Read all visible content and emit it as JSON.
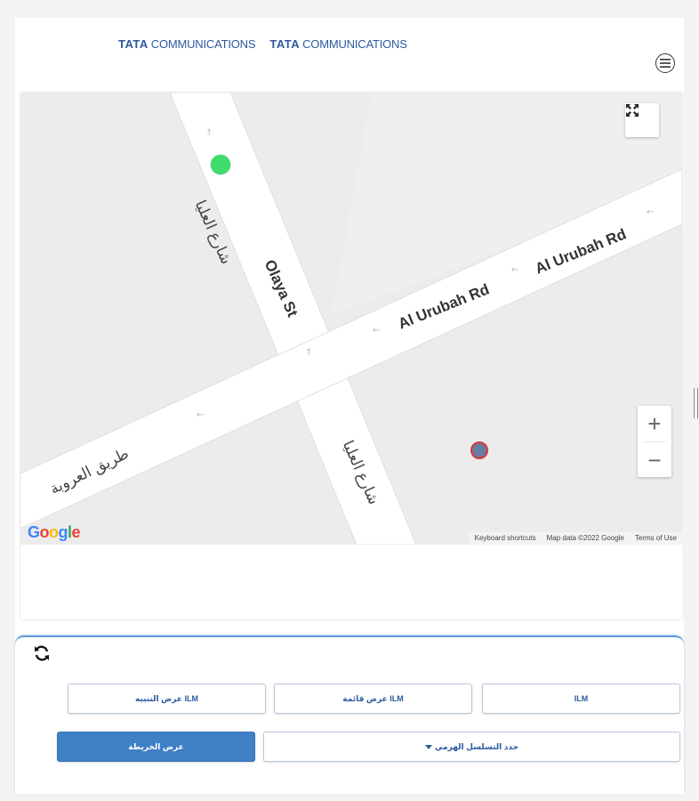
{
  "header": {
    "logos": [
      {
        "brand": "TATA",
        "name": "COMMUNICATIONS"
      },
      {
        "brand": "TATA",
        "name": "COMMUNICATIONS"
      }
    ]
  },
  "map": {
    "labels": {
      "olaya_en": "Olaya St",
      "olaya_ar_top": "شارع العليا",
      "olaya_ar_bottom": "شارع العليا",
      "urubah_1": "Al Urubah Rd",
      "urubah_2": "Al Urubah Rd",
      "urubah_ar": "طريق العروبة"
    },
    "google_logo": "Google",
    "footer": {
      "shortcuts": "Keyboard shortcuts",
      "map_data": "Map Data",
      "copyright": "Map data ©2022 Google",
      "terms": "Terms of Use"
    },
    "zoom_in": "+",
    "zoom_out": "−",
    "colors": {
      "marker_green": "#3ddc6b",
      "marker_red": "#d9383a"
    }
  },
  "controls": {
    "row1": {
      "ilm": "ILM",
      "ilm_list": "عرض قائمة ILM",
      "ilm_alarm": "عرض التنبيه ILM"
    },
    "row2": {
      "hierarchy": "حدد التسلسل الهرمي",
      "show_map": "عرض الخريطة"
    }
  }
}
